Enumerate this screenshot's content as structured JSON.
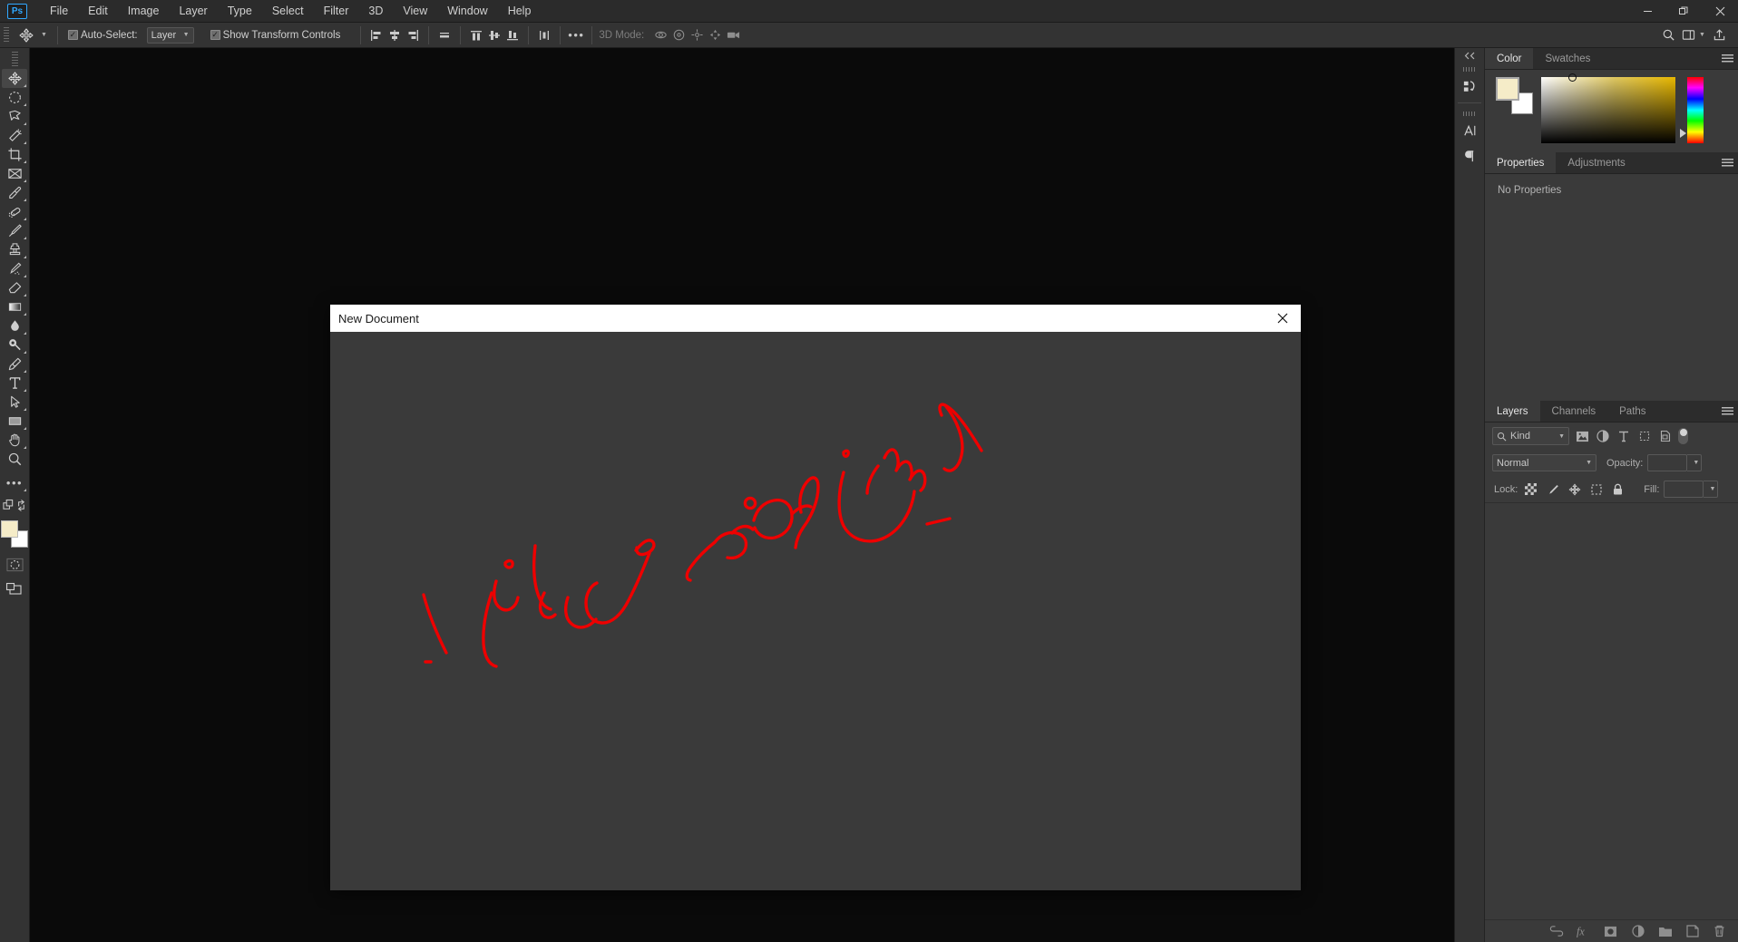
{
  "app": {
    "logo": "Ps",
    "menus": [
      "File",
      "Edit",
      "Image",
      "Layer",
      "Type",
      "Select",
      "Filter",
      "3D",
      "View",
      "Window",
      "Help"
    ],
    "window_controls": [
      {
        "name": "minimize",
        "glyph": "—"
      },
      {
        "name": "maximize",
        "glyph": "❐"
      },
      {
        "name": "close",
        "glyph": "✕"
      }
    ]
  },
  "options_bar": {
    "auto_select_label": "Auto-Select:",
    "auto_select_checked": true,
    "auto_select_scope": "Layer",
    "show_transform_label": "Show Transform Controls",
    "show_transform_checked": true,
    "align_icons": [
      "align-left-edges",
      "align-horizontal-centers",
      "align-right-edges",
      "align-top-edges",
      "distribute-top-edges",
      "distribute-vertical-centers",
      "distribute-bottom-edges",
      "distribute-horizontal"
    ],
    "more_label": "•••",
    "mode_3d_label": "3D Mode:",
    "mode_3d_icons": [
      "orbit-3d",
      "roll-3d",
      "pan-3d",
      "slide-3d",
      "camera-3d"
    ],
    "right_icons": [
      "search-icon",
      "workspace-icon",
      "share-icon"
    ]
  },
  "tools": [
    {
      "name": "move-tool",
      "active": true
    },
    {
      "name": "marquee-tool",
      "active": false
    },
    {
      "name": "lasso-tool",
      "active": false
    },
    {
      "name": "magic-wand-tool",
      "active": false
    },
    {
      "name": "crop-tool",
      "active": false
    },
    {
      "name": "frame-tool",
      "active": false
    },
    {
      "name": "eyedropper-tool",
      "active": false
    },
    {
      "name": "healing-brush-tool",
      "active": false
    },
    {
      "name": "brush-tool",
      "active": false
    },
    {
      "name": "clone-stamp-tool",
      "active": false
    },
    {
      "name": "history-brush-tool",
      "active": false
    },
    {
      "name": "eraser-tool",
      "active": false
    },
    {
      "name": "gradient-tool",
      "active": false
    },
    {
      "name": "blur-tool",
      "active": false
    },
    {
      "name": "dodge-tool",
      "active": false
    },
    {
      "name": "pen-tool",
      "active": false
    },
    {
      "name": "type-tool",
      "active": false
    },
    {
      "name": "path-selection-tool",
      "active": false
    },
    {
      "name": "rectangle-tool",
      "active": false
    },
    {
      "name": "hand-tool",
      "active": false
    },
    {
      "name": "zoom-tool",
      "active": false
    },
    {
      "name": "edit-toolbar-tool",
      "active": false
    }
  ],
  "tool_colors": {
    "foreground": "#f5ecc8",
    "background": "#ffffff"
  },
  "dialog": {
    "title": "New Document",
    "close_glyph": "✕",
    "ink_color": "#ee0000"
  },
  "rail": {
    "collapse_glyph": "«",
    "icons": [
      "history-icon",
      "character-icon",
      "paragraph-icon"
    ]
  },
  "color_panel": {
    "tabs": [
      {
        "label": "Color",
        "active": true
      },
      {
        "label": "Swatches",
        "active": false
      }
    ],
    "foreground": "#f5ecc8",
    "background": "#ffffff"
  },
  "properties_panel": {
    "tabs": [
      {
        "label": "Properties",
        "active": true
      },
      {
        "label": "Adjustments",
        "active": false
      }
    ],
    "empty_text": "No Properties"
  },
  "layers_panel": {
    "tabs": [
      {
        "label": "Layers",
        "active": true
      },
      {
        "label": "Channels",
        "active": false
      },
      {
        "label": "Paths",
        "active": false
      }
    ],
    "filter_label": "Kind",
    "filter_icons": [
      "pixel-filter-icon",
      "adjustment-filter-icon",
      "type-filter-icon",
      "shape-filter-icon",
      "smart-object-filter-icon"
    ],
    "blend_mode": "Normal",
    "opacity_label": "Opacity:",
    "opacity_value": "",
    "lock_label": "Lock:",
    "lock_icons": [
      "lock-transparent-pixels-icon",
      "lock-image-pixels-icon",
      "lock-position-icon",
      "lock-artboard-icon",
      "lock-all-icon"
    ],
    "fill_label": "Fill:",
    "fill_value": "",
    "footer_icons": [
      "link-layers-icon",
      "layer-style-icon",
      "add-mask-icon",
      "adjustment-layer-icon",
      "new-group-icon",
      "new-layer-icon",
      "delete-layer-icon"
    ],
    "footer_fx_label": "fx"
  }
}
